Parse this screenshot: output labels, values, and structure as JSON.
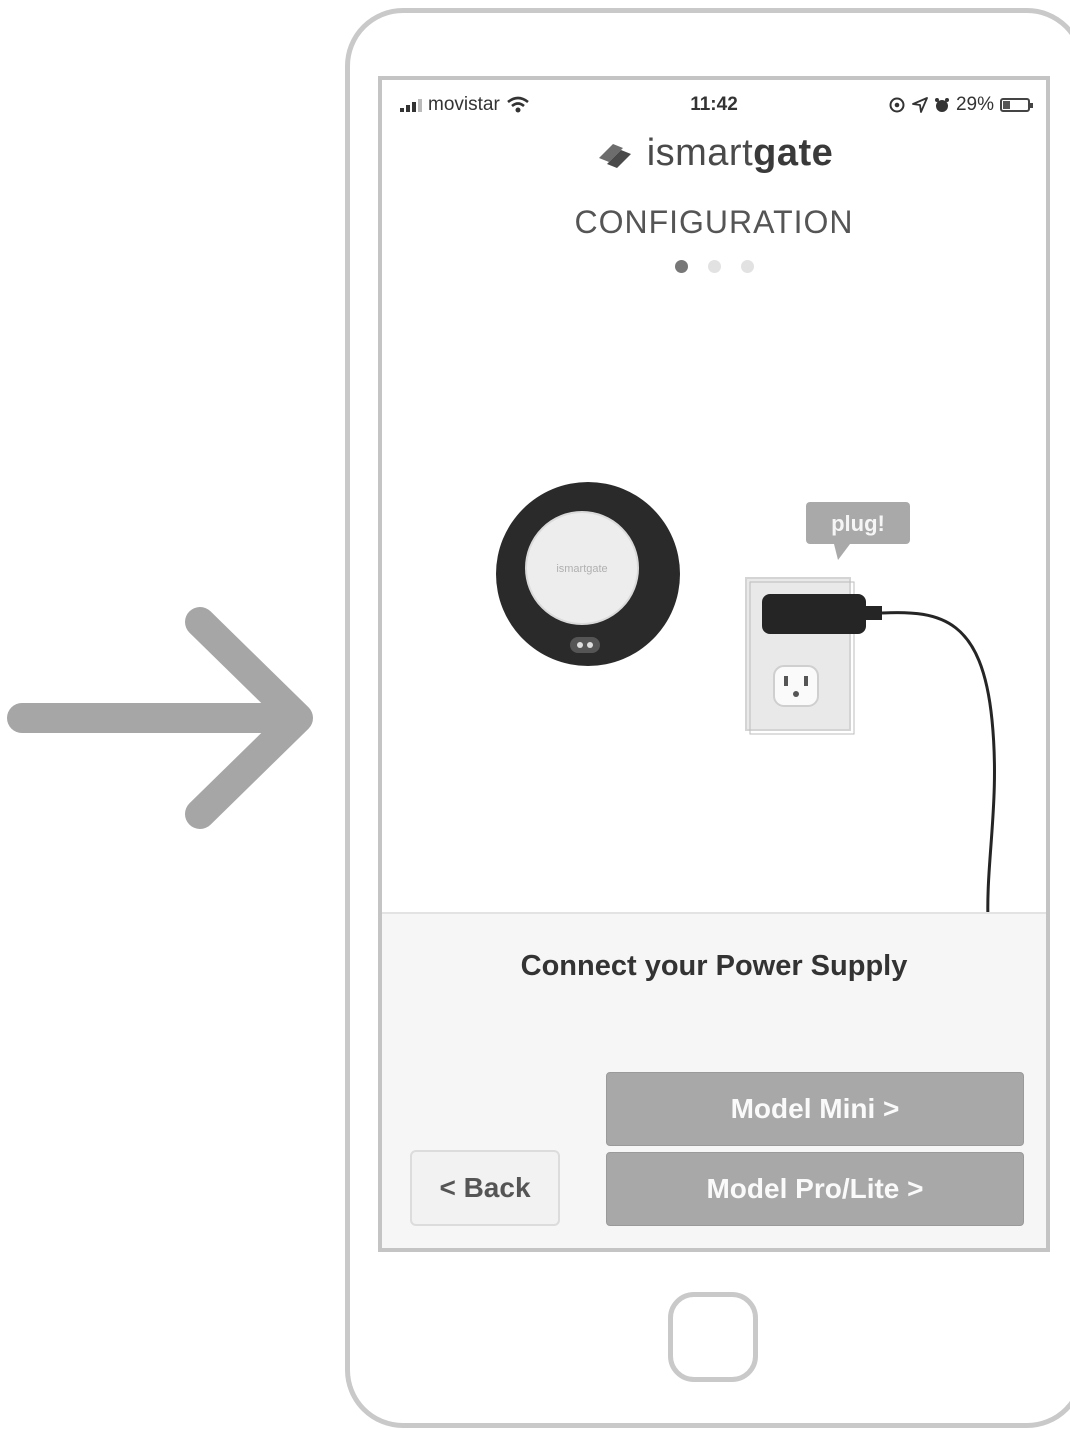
{
  "status_bar": {
    "carrier": "movistar",
    "time": "11:42",
    "battery": "29%",
    "battery_level": 0.29
  },
  "app": {
    "logo_prefix": "ismart",
    "logo_suffix": "gate"
  },
  "header": {
    "title": "CONFIGURATION",
    "steps_total": 3,
    "current_step": 1
  },
  "illustration": {
    "hub_label": "ismartgate",
    "speech_bubble": "plug!"
  },
  "footer": {
    "instruction": "Connect your Power Supply",
    "back_label": "< Back",
    "model_mini_label": "Model Mini >",
    "model_pro_label": "Model Pro/Lite >"
  },
  "colors": {
    "button_gray": "#a8a8a8",
    "arrow_gray": "#a6a6a6",
    "device_black": "#2a2a2a"
  },
  "icons": {
    "pointer": "arrow-right-icon",
    "signal": "signal-bars-icon",
    "wifi": "wifi-icon",
    "logo": "ismartgate-logo-icon"
  }
}
